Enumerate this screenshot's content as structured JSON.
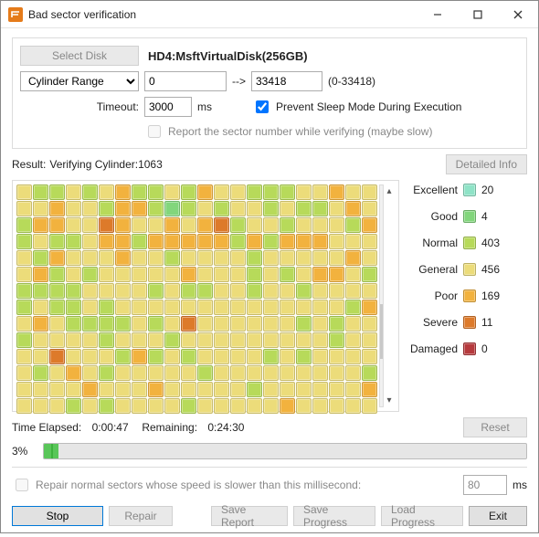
{
  "titlebar": {
    "title": "Bad sector verification"
  },
  "config": {
    "select_disk_label": "Select Disk",
    "disk_label": "HD4:MsftVirtualDisk(256GB)",
    "range_mode": "Cylinder Range",
    "range_from": "0",
    "range_arrow": "-->",
    "range_to": "33418",
    "range_hint": "(0-33418)",
    "timeout_label": "Timeout:",
    "timeout_value": "3000",
    "timeout_unit": "ms",
    "prevent_sleep_label": "Prevent Sleep Mode During Execution",
    "prevent_sleep_checked": true,
    "report_sector_label": "Report the sector number while verifying (maybe slow)",
    "report_sector_checked": false
  },
  "result": {
    "label": "Result:",
    "status": "Verifying Cylinder:1063",
    "detailed_btn": "Detailed Info",
    "reset_btn": "Reset"
  },
  "legend": [
    {
      "label": "Excellent",
      "cls": "c-excellent",
      "count": "20"
    },
    {
      "label": "Good",
      "cls": "c-good",
      "count": "4"
    },
    {
      "label": "Normal",
      "cls": "c-normal",
      "count": "403"
    },
    {
      "label": "General",
      "cls": "c-general",
      "count": "456"
    },
    {
      "label": "Poor",
      "cls": "c-poor",
      "count": "169"
    },
    {
      "label": "Severe",
      "cls": "c-severe",
      "count": "11"
    },
    {
      "label": "Damaged",
      "cls": "c-damaged",
      "count": "0"
    }
  ],
  "grid": {
    "cols": 22,
    "rows": 14,
    "cells": "GNNGNGPNNGNPGGNnNGGPGG|GGPGGnPPNgNGNGGNGNNGPG|NPPGGsPGGPGPsNGGNGGGNP|NGNNGPPNPPPPPNPNPPPGGG|GNPGGGPGGNGGGGNGGGGGPG|GPNGNGGGGGPGGGNGNGPPGN|NNNNGGGGNGNNGGNGGNGGGG|NGNNGNGGGGGGGGGGGGGGNP|GPGNNNNGNGsGGGGGGNGNGG|NGGGGNGGGNGGGGGGGGGNGG|GGsGGGNPNGNGGGGNGNGGGG|GNGPGNGGGGGNGGGGGGGGGN|GGGGPGGGPGGGGGNGGGGGGP|GGGNGNGGGGNGGGGGPGGGGG"
  },
  "time": {
    "elapsed_label": "Time Elapsed:",
    "elapsed": "0:00:47",
    "remaining_label": "Remaining:",
    "remaining": "0:24:30"
  },
  "progress": {
    "pct_text": "3%",
    "pct": 3
  },
  "repair": {
    "label": "Repair normal sectors whose speed is slower than this millisecond:",
    "value": "80",
    "unit": "ms",
    "checked": false
  },
  "buttons": {
    "stop": "Stop",
    "repair": "Repair",
    "save_report": "Save Report",
    "save_progress": "Save Progress",
    "load_progress": "Load Progress",
    "exit": "Exit"
  }
}
